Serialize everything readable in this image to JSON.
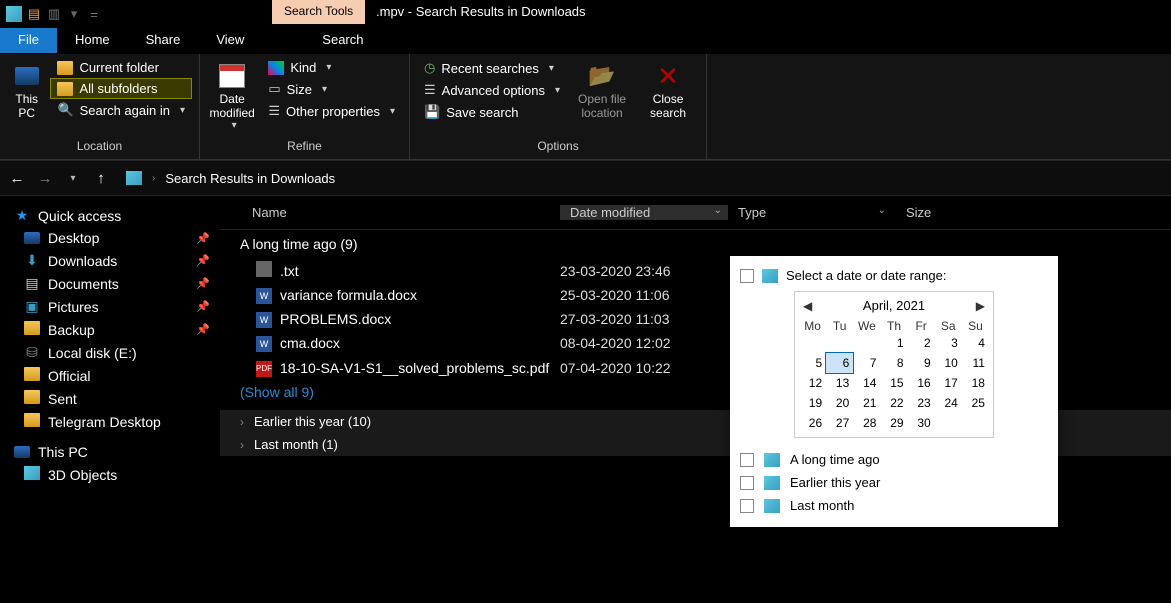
{
  "window": {
    "context_tab": "Search Tools",
    "title": ".mpv - Search Results in Downloads"
  },
  "tabs": {
    "file": "File",
    "home": "Home",
    "share": "Share",
    "view": "View",
    "search": "Search"
  },
  "ribbon": {
    "location": {
      "this_pc": "This PC",
      "current_folder": "Current folder",
      "all_subfolders": "All subfolders",
      "search_again": "Search again in",
      "label": "Location"
    },
    "refine": {
      "date_modified": "Date modified",
      "kind": "Kind",
      "size": "Size",
      "other_properties": "Other properties",
      "label": "Refine"
    },
    "options": {
      "recent_searches": "Recent searches",
      "advanced_options": "Advanced options",
      "save_search": "Save search",
      "open_file_location": "Open file location",
      "close_search": "Close search",
      "label": "Options"
    }
  },
  "breadcrumb": {
    "location": "Search Results in Downloads"
  },
  "sidebar": {
    "quick_access": "Quick access",
    "items": [
      {
        "icon": "desktop",
        "label": "Desktop",
        "pinned": true
      },
      {
        "icon": "downloads",
        "label": "Downloads",
        "pinned": true
      },
      {
        "icon": "documents",
        "label": "Documents",
        "pinned": true
      },
      {
        "icon": "pictures",
        "label": "Pictures",
        "pinned": true
      },
      {
        "icon": "folder",
        "label": "Backup",
        "pinned": true
      },
      {
        "icon": "disk",
        "label": "Local disk (E:)",
        "pinned": false
      },
      {
        "icon": "folder",
        "label": "Official",
        "pinned": false
      },
      {
        "icon": "folder",
        "label": "Sent",
        "pinned": false
      },
      {
        "icon": "folder",
        "label": "Telegram Desktop",
        "pinned": false
      }
    ],
    "this_pc": "This PC",
    "this_pc_items": [
      {
        "icon": "cube",
        "label": "3D Objects"
      }
    ]
  },
  "columns": {
    "name": "Name",
    "date_modified": "Date modified",
    "type": "Type",
    "size": "Size"
  },
  "groups": [
    {
      "header": "A long time ago (9)",
      "expanded": true,
      "rows": [
        {
          "icon": "txt",
          "name": ".txt",
          "date": "23-03-2020 23:46"
        },
        {
          "icon": "word",
          "name": "variance formula.docx",
          "date": "25-03-2020 11:06"
        },
        {
          "icon": "word",
          "name": "PROBLEMS.docx",
          "date": "27-03-2020 11:03"
        },
        {
          "icon": "word",
          "name": "cma.docx",
          "date": "08-04-2020 12:02"
        },
        {
          "icon": "pdf",
          "name": "18-10-SA-V1-S1__solved_problems_sc.pdf",
          "date": "07-04-2020 10:22"
        }
      ],
      "show_all": "(Show all 9)"
    },
    {
      "header": "Earlier this year (10)",
      "expanded": false
    },
    {
      "header": "Last month (1)",
      "expanded": false
    }
  ],
  "date_popup": {
    "title": "Select a date or date range:",
    "month": "April, 2021",
    "dow": [
      "Mo",
      "Tu",
      "We",
      "Th",
      "Fr",
      "Sa",
      "Su"
    ],
    "weeks": [
      [
        "",
        "",
        "",
        "1",
        "2",
        "3",
        "4"
      ],
      [
        "5",
        "6",
        "7",
        "8",
        "9",
        "10",
        "11"
      ],
      [
        "12",
        "13",
        "14",
        "15",
        "16",
        "17",
        "18"
      ],
      [
        "19",
        "20",
        "21",
        "22",
        "23",
        "24",
        "25"
      ],
      [
        "26",
        "27",
        "28",
        "29",
        "30",
        "",
        ""
      ]
    ],
    "today": "6",
    "options": [
      "A long time ago",
      "Earlier this year",
      "Last month"
    ]
  }
}
